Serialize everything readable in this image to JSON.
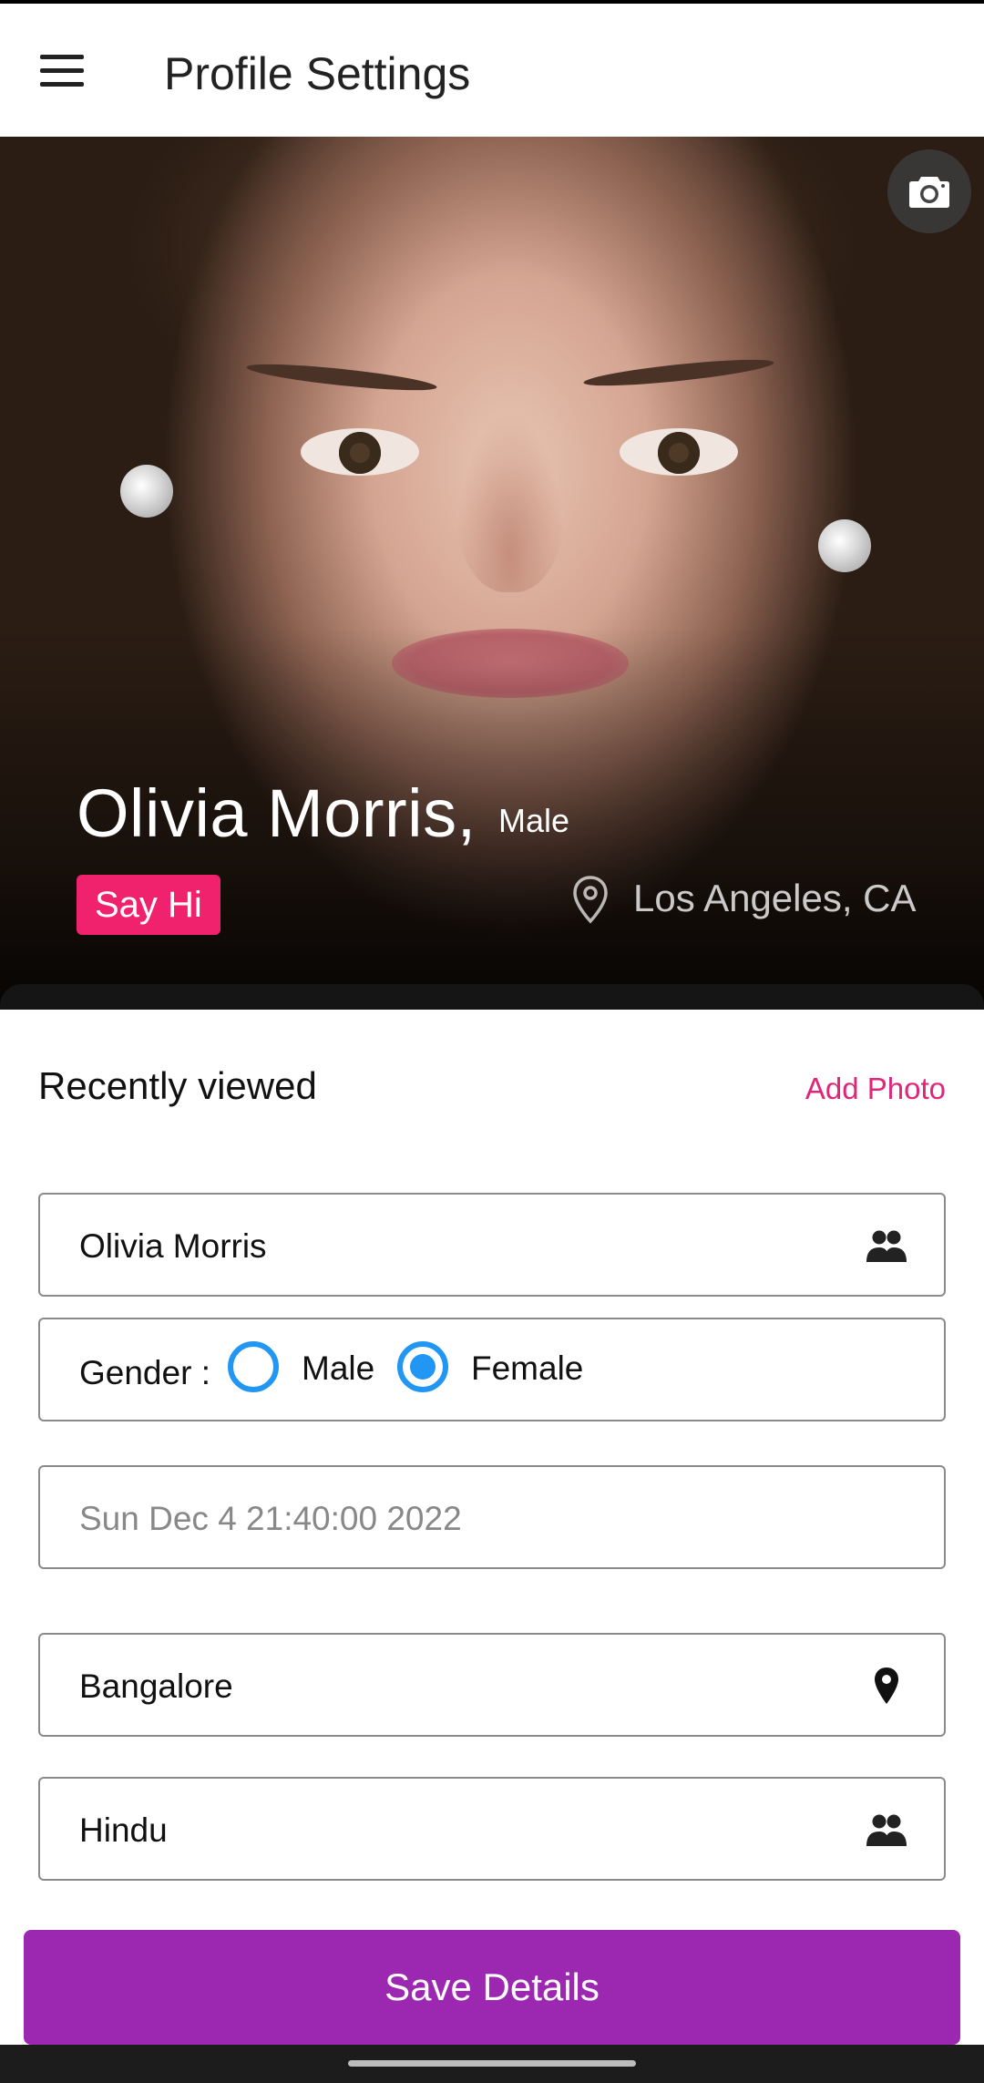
{
  "appbar": {
    "title": "Profile Settings",
    "menu_icon": "hamburger-menu-icon"
  },
  "hero": {
    "name": "Olivia Morris,",
    "gender": "Male",
    "say_hi_label": "Say Hi",
    "location": "Los Angeles, CA",
    "camera_icon": "camera-icon",
    "location_icon": "map-pin-outline-icon",
    "accent_color": "#f0226e"
  },
  "section": {
    "title": "Recently viewed",
    "add_photo_label": "Add Photo",
    "link_color": "#e0267a"
  },
  "form": {
    "name_value": "Olivia Morris",
    "name_icon": "people-icon",
    "gender_label": "Gender :",
    "gender_options": [
      "Male",
      "Female"
    ],
    "gender_selected": "Female",
    "dob_value": "Sun Dec  4 21:40:00 2022",
    "city_value": "Bangalore",
    "city_icon": "map-pin-icon",
    "religion_value": "Hindu",
    "religion_icon": "people-icon",
    "radio_color": "#2196f3"
  },
  "save_button": {
    "label": "Save Details",
    "color": "#9c27b0"
  }
}
